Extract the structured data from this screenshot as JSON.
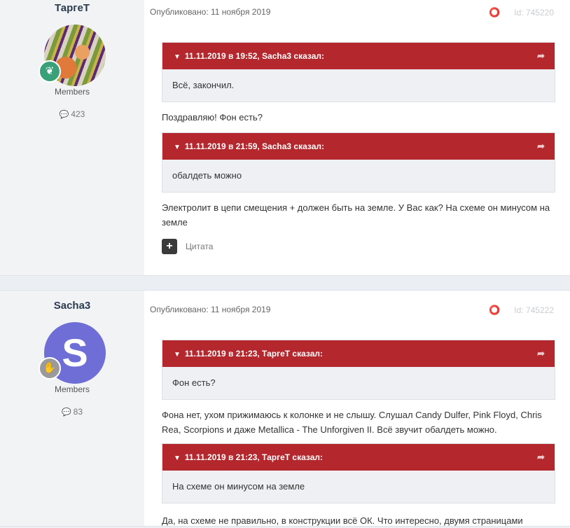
{
  "posts": [
    {
      "author": "ТаргеТ",
      "group": "Members",
      "post_count": "423",
      "published": "Опубликовано: 11 ноября 2019",
      "post_id": "Id: 745220",
      "quotes": [
        {
          "header": "11.11.2019 в 19:52, Sacha3 сказал:",
          "body": "Всё, закончил."
        },
        {
          "header": "11.11.2019 в 21:59, Sacha3 сказал:",
          "body": "обалдеть можно"
        }
      ],
      "texts": [
        "Поздравляю!  Фон есть?",
        "Электролит в цепи смещения + должен быть на земле. У Вас как? На схеме он минусом на земле"
      ],
      "quote_button": "Цитата"
    },
    {
      "author": "Sacha3",
      "avatar_letter": "S",
      "group": "Members",
      "post_count": "83",
      "published": "Опубликовано: 11 ноября 2019",
      "post_id": "Id: 745222",
      "quotes": [
        {
          "header": "11.11.2019 в 21:23, ТаргеТ сказал:",
          "body": "Фон есть?"
        },
        {
          "header": "11.11.2019 в 21:23, ТаргеТ сказал:",
          "body": "На схеме он минусом на земле"
        }
      ],
      "texts": [
        "Фона нет, ухом прижимаюсь к колонке и не слышу. Слушал Candy Dulfer, Pink Floyd, Chris Rea, Scorpions и даже Metallica - The Unforgiven II. Всё звучит обалдеть можно.",
        "Да, на схеме не правильно, в конструкции всё ОК. Что интересно, двумя страницами"
      ]
    }
  ],
  "icons": {
    "chevron": "chevron-down-icon",
    "jump": "share-arrow-icon",
    "share": "share-icon",
    "comment": "comment-icon",
    "rank_leaf": "leaf-icon",
    "rank_hand": "hand-icon"
  },
  "colors": {
    "quote_header": "#b3272d",
    "author_column": "#f2f3f5",
    "avatar_purple": "#6f6ed6",
    "rank_green": "#3aa07a"
  }
}
